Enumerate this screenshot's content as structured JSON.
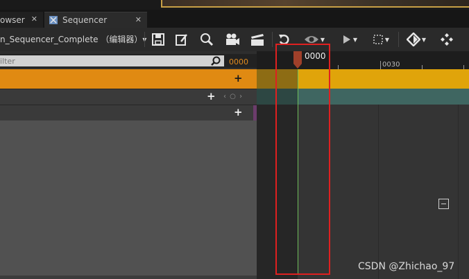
{
  "tabs": {
    "browser_label": "owser",
    "sequencer_label": "Sequencer",
    "close_glyph": "✕"
  },
  "toolbar": {
    "sequence_name": "n_Sequencer_Complete （编辑器）▾",
    "icons": [
      "save-icon",
      "save-as-icon",
      "search-icon",
      "camera-icon",
      "render-movie-icon",
      "undo-icon",
      "view-options-icon",
      "play-icon",
      "selection-icon",
      "keyframe-icon",
      "snap-icon"
    ]
  },
  "left_panel": {
    "search_placeholder": "ilter",
    "current_frame": "0000",
    "add_glyph": "+",
    "key_nav": "‹ ○ ›"
  },
  "timeline": {
    "playhead_frame": "0000",
    "tick_label": "0030"
  },
  "colors": {
    "camera_track": "#e08a12",
    "camera_lane": "#e0a40a",
    "teal_lane": "#3f6661",
    "playhead": "#6fbf5a",
    "highlight": "#e02020"
  },
  "watermark": "CSDN @Zhichao_97"
}
